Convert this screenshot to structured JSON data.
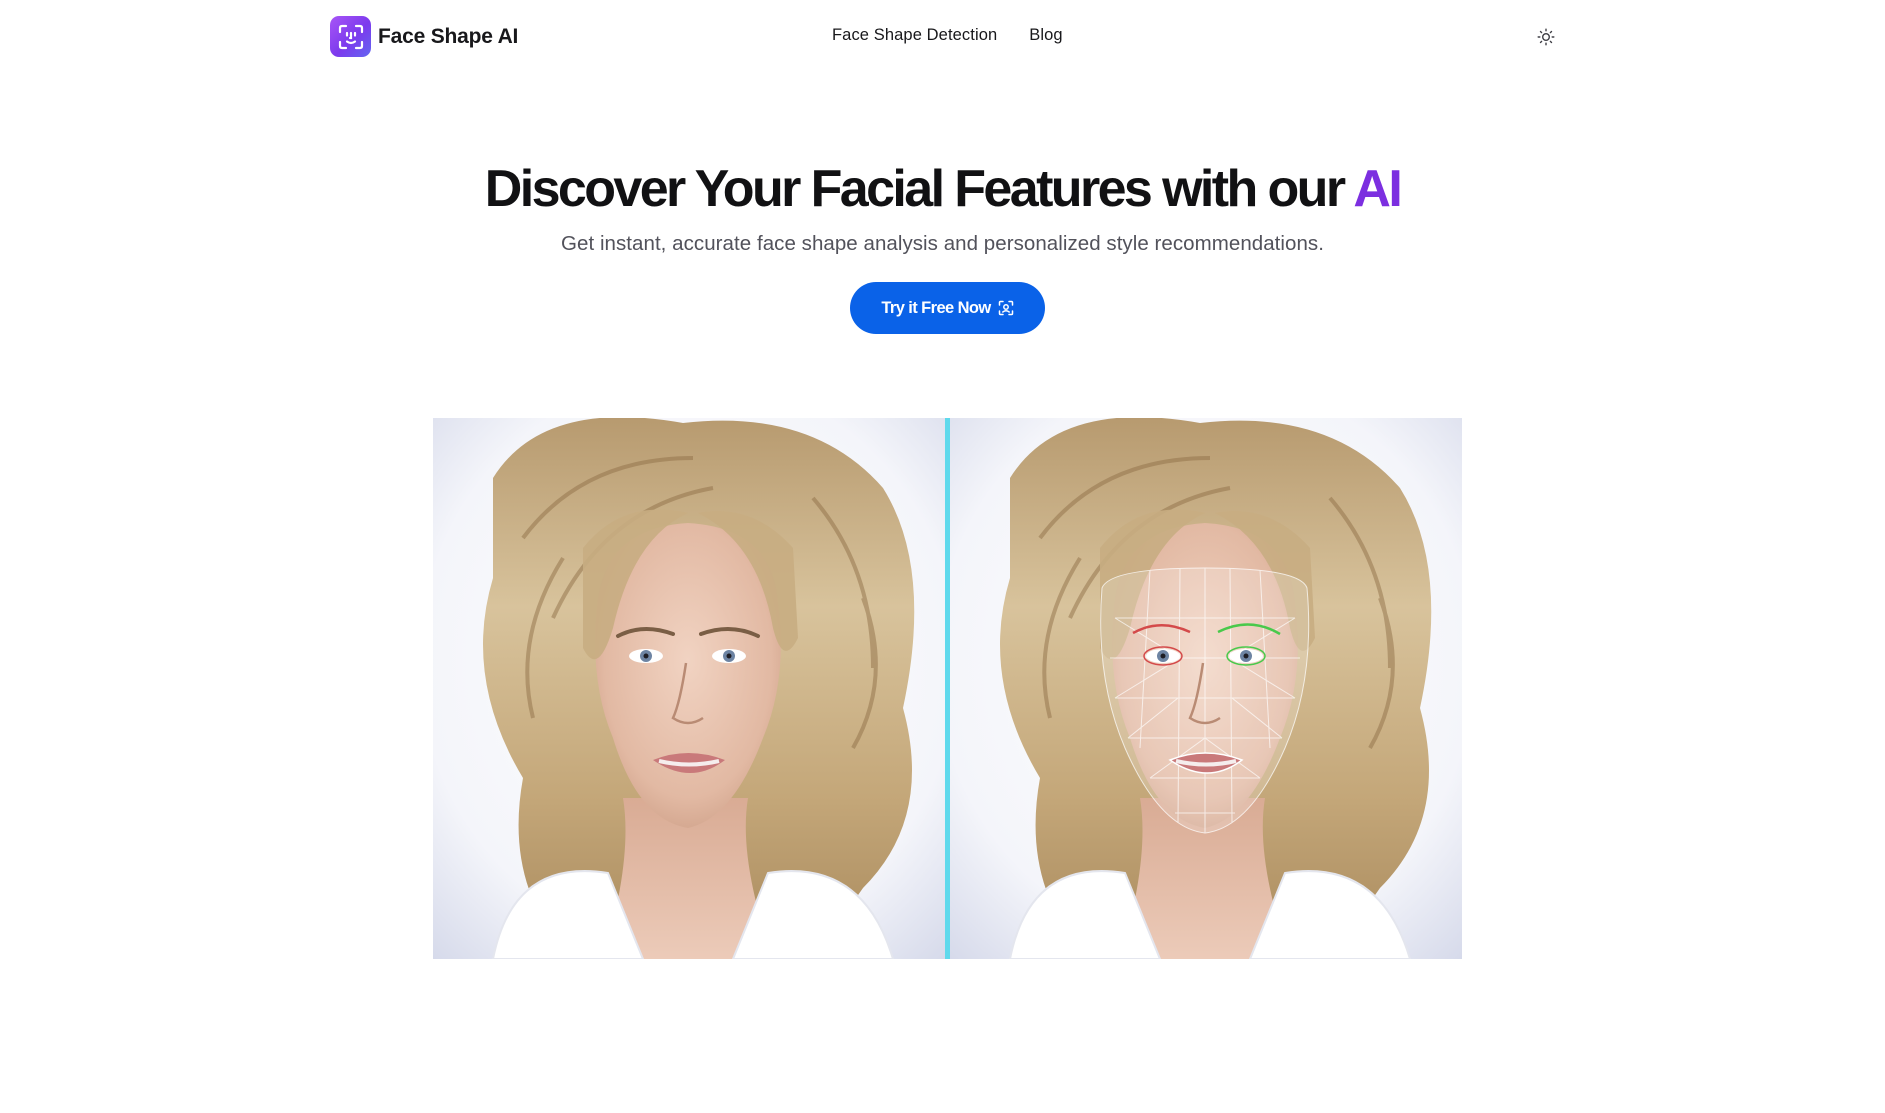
{
  "header": {
    "brand_name": "Face Shape AI",
    "logo_icon": "face-scan-icon",
    "nav": [
      {
        "label": "Face Shape Detection"
      },
      {
        "label": "Blog"
      }
    ],
    "theme_toggle_icon": "sun-icon"
  },
  "hero": {
    "title_main": "Discover Your Facial Features with our ",
    "title_accent": "AI",
    "subtitle": "Get instant, accurate face shape analysis and personalized style recommendations.",
    "cta_label": "Try it Free Now",
    "cta_icon": "face-scan-icon"
  },
  "comparison": {
    "left_image": "original-portrait",
    "right_image": "portrait-with-face-mesh",
    "divider_position_fraction": 0.5
  },
  "colors": {
    "accent_purple": "#7c2fe0",
    "cta_blue": "#0a62e8",
    "divider_cyan": "#5fd9ec",
    "logo_gradient_start": "#a855f7",
    "logo_gradient_end": "#6366f1"
  }
}
